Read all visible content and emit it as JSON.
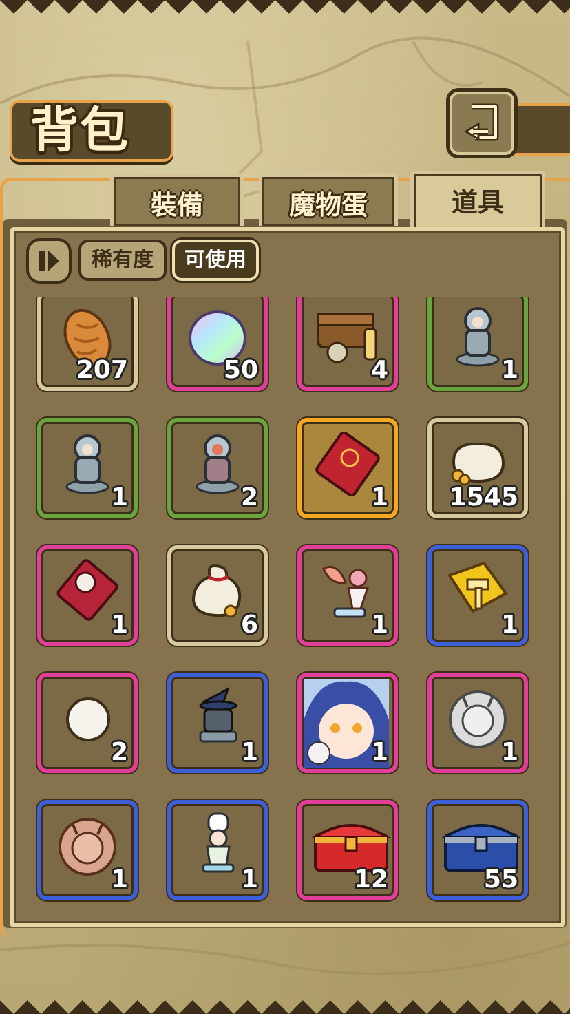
{
  "page": {
    "title": "背包"
  },
  "tabs": [
    {
      "label": "裝備",
      "active": false
    },
    {
      "label": "魔物蛋",
      "active": false
    },
    {
      "label": "道具",
      "active": true
    }
  ],
  "filters": {
    "rarity": "稀有度",
    "usable": "可使用"
  },
  "colors": {
    "white": "#d8caa0",
    "green": "#6aa43e",
    "pink": "#e0409a",
    "gold": "#f5a623",
    "blue": "#3d5fd8"
  },
  "items": [
    {
      "icon": "bread-icon",
      "count": "207",
      "rarity": "white"
    },
    {
      "icon": "rainbow-egg-icon",
      "count": "50",
      "rarity": "pink"
    },
    {
      "icon": "supply-chest-icon",
      "count": "4",
      "rarity": "pink"
    },
    {
      "icon": "knight-figure-icon",
      "count": "1",
      "rarity": "green"
    },
    {
      "icon": "knight-figure-icon",
      "count": "1",
      "rarity": "green"
    },
    {
      "icon": "knight-figure-red-icon",
      "count": "2",
      "rarity": "green"
    },
    {
      "icon": "red-envelope-icon",
      "count": "1",
      "rarity": "gold"
    },
    {
      "icon": "coin-sack-icon",
      "count": "1545",
      "rarity": "white"
    },
    {
      "icon": "rat-envelope-icon",
      "count": "1",
      "rarity": "pink"
    },
    {
      "icon": "coin-bag-icon",
      "count": "6",
      "rarity": "white"
    },
    {
      "icon": "feather-girl-figure-icon",
      "count": "1",
      "rarity": "pink"
    },
    {
      "icon": "golden-puzzle-hammer-icon",
      "count": "1",
      "rarity": "blue"
    },
    {
      "icon": "white-orb-icon",
      "count": "2",
      "rarity": "pink"
    },
    {
      "icon": "witch-robot-figure-icon",
      "count": "1",
      "rarity": "blue"
    },
    {
      "icon": "anime-girl-portrait-icon",
      "count": "1",
      "rarity": "pink"
    },
    {
      "icon": "silver-challenge-medal-icon",
      "count": "1",
      "rarity": "pink"
    },
    {
      "icon": "bronze-challenge-medal-icon",
      "count": "1",
      "rarity": "blue"
    },
    {
      "icon": "chef-figure-icon",
      "count": "1",
      "rarity": "blue"
    },
    {
      "icon": "red-treasure-chest-icon",
      "count": "12",
      "rarity": "pink"
    },
    {
      "icon": "blue-treasure-chest-icon",
      "count": "55",
      "rarity": "blue"
    }
  ]
}
